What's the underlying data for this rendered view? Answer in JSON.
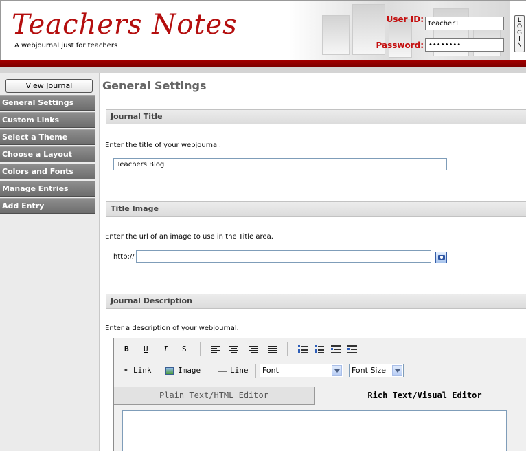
{
  "header": {
    "title": "Teachers Notes",
    "subtitle": "A webjournal just for teachers",
    "login": {
      "user_id_label": "User ID:",
      "user_id_value": "teacher1",
      "password_label": "Password:",
      "password_value": "password",
      "login_button": "LOGIN"
    }
  },
  "sidebar": {
    "view_journal": "View Journal",
    "items": [
      {
        "label": "General Settings"
      },
      {
        "label": "Custom Links"
      },
      {
        "label": "Select a Theme"
      },
      {
        "label": "Choose a Layout"
      },
      {
        "label": "Colors and Fonts"
      },
      {
        "label": "Manage Entries"
      },
      {
        "label": "Add Entry"
      }
    ]
  },
  "main": {
    "page_title": "General Settings",
    "journal_title": {
      "header": "Journal Title",
      "instruction": "Enter the title of your webjournal.",
      "value": "Teachers Blog"
    },
    "title_image": {
      "header": "Title Image",
      "instruction": "Enter the url of an image to use in the Title area.",
      "prefix": "http://",
      "value": "",
      "browse_icon": "image-browse-icon"
    },
    "journal_description": {
      "header": "Journal Description",
      "instruction": "Enter a description of your webjournal."
    },
    "editor": {
      "toolbar": {
        "bold": "B",
        "underline": "U",
        "italic": "I",
        "strike": "S",
        "link": "Link",
        "image": "Image",
        "line": "Line",
        "font": "Font",
        "font_size": "Font Size"
      },
      "tabs": {
        "plain": "Plain Text/HTML Editor",
        "rich": "Rich Text/Visual Editor"
      },
      "active_tab": "rich"
    }
  },
  "colors": {
    "brand_red": "#b40e0e",
    "sidebar_item": "#7a7a7a"
  }
}
